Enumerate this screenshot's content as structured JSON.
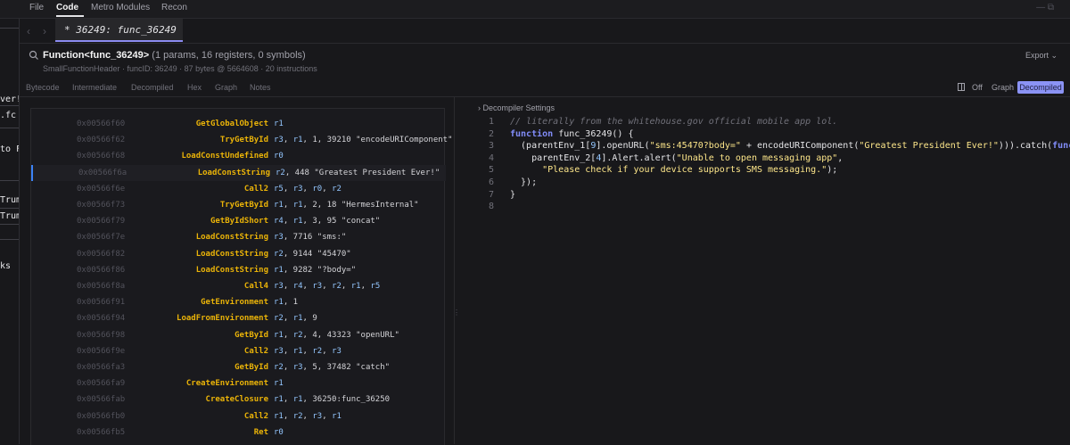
{
  "menu": {
    "file": "File",
    "code": "Code",
    "metro": "Metro Modules",
    "recon": "Recon",
    "window_controls": "— ⧉"
  },
  "left_strip": [
    "ver!",
    ".fc",
    "to F",
    "Trum",
    "Trum",
    "ks"
  ],
  "tab": {
    "title": "* 36249: func_36249"
  },
  "header": {
    "name": "Function<func_36249>",
    "meta": "(1 params, 16 registers, 0 symbols)",
    "sub": "SmallFunctionHeader · funcID: 36249 · 87 bytes @ 5664608 · 20 instructions",
    "export": "Export ⌄"
  },
  "views": {
    "bytecode": "Bytecode",
    "intermediate": "Intermediate",
    "decompiled": "Decompiled",
    "hex": "Hex",
    "graph": "Graph",
    "notes": "Notes"
  },
  "view_options": {
    "off": "Off",
    "graph": "Graph",
    "decompiled": "Decompiled"
  },
  "bytecode": [
    {
      "addr": "0x00566f60",
      "op": "GetGlobalObject",
      "args": "r1"
    },
    {
      "addr": "0x00566f62",
      "op": "TryGetById",
      "args": "r3, r1, 1, 39210 \"encodeURIComponent\""
    },
    {
      "addr": "0x00566f68",
      "op": "LoadConstUndefined",
      "args": "r0"
    },
    {
      "addr": "0x00566f6a",
      "op": "LoadConstString",
      "args": "r2, 448 \"Greatest President Ever!\""
    },
    {
      "addr": "0x00566f6e",
      "op": "Call2",
      "args": "r5, r3, r0, r2"
    },
    {
      "addr": "0x00566f73",
      "op": "TryGetById",
      "args": "r1, r1, 2, 18 \"HermesInternal\""
    },
    {
      "addr": "0x00566f79",
      "op": "GetByIdShort",
      "args": "r4, r1, 3, 95 \"concat\""
    },
    {
      "addr": "0x00566f7e",
      "op": "LoadConstString",
      "args": "r3, 7716 \"sms:\""
    },
    {
      "addr": "0x00566f82",
      "op": "LoadConstString",
      "args": "r2, 9144 \"45470\""
    },
    {
      "addr": "0x00566f86",
      "op": "LoadConstString",
      "args": "r1, 9282 \"?body=\""
    },
    {
      "addr": "0x00566f8a",
      "op": "Call4",
      "args": "r3, r4, r3, r2, r1, r5"
    },
    {
      "addr": "0x00566f91",
      "op": "GetEnvironment",
      "args": "r1, 1"
    },
    {
      "addr": "0x00566f94",
      "op": "LoadFromEnvironment",
      "args": "r2, r1, 9"
    },
    {
      "addr": "0x00566f98",
      "op": "GetById",
      "args": "r1, r2, 4, 43323 \"openURL\""
    },
    {
      "addr": "0x00566f9e",
      "op": "Call2",
      "args": "r3, r1, r2, r3"
    },
    {
      "addr": "0x00566fa3",
      "op": "GetById",
      "args": "r2, r3, 5, 37482 \"catch\""
    },
    {
      "addr": "0x00566fa9",
      "op": "CreateEnvironment",
      "args": "r1"
    },
    {
      "addr": "0x00566fab",
      "op": "CreateClosure",
      "args": "r1, r1, 36250:func_36250"
    },
    {
      "addr": "0x00566fb0",
      "op": "Call2",
      "args": "r1, r2, r3, r1"
    },
    {
      "addr": "0x00566fb5",
      "op": "Ret",
      "args": "r0"
    }
  ],
  "decompiler": {
    "settings_label": "Decompiler Settings",
    "lines": [
      {
        "n": "1",
        "text": "// literally from the whitehouse.gov official mobile app lol."
      },
      {
        "n": "2",
        "text": "function func_36249() {"
      },
      {
        "n": "3",
        "text": "  (parentEnv_1[9].openURL(\"sms:45470?body=\" + encodeURIComponent(\"Greatest President Ever!\"))).catch(function() {"
      },
      {
        "n": "4",
        "text": "    parentEnv_2[4].Alert.alert(\"Unable to open messaging app\","
      },
      {
        "n": "5",
        "text": "      \"Please check if your device supports SMS messaging.\");"
      },
      {
        "n": "6",
        "text": "  });"
      },
      {
        "n": "7",
        "text": "}"
      },
      {
        "n": "8",
        "text": ""
      }
    ]
  },
  "colors": {
    "accent": "#8b93f5",
    "opcode": "#eab308",
    "keyword": "#818cf8"
  }
}
